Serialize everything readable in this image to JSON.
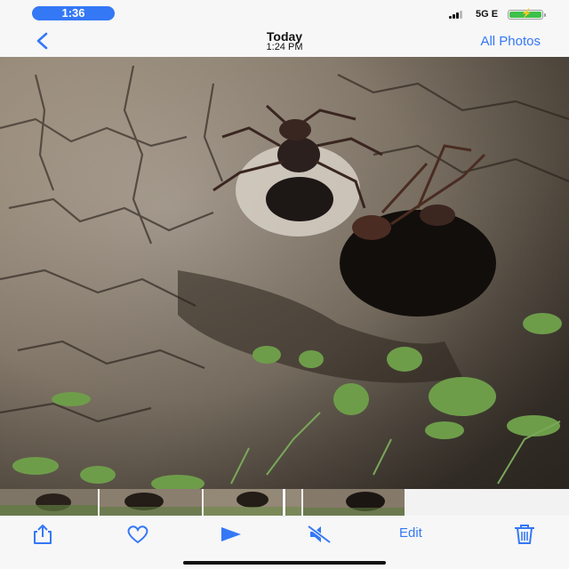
{
  "status_bar": {
    "time": "1:36",
    "network": "5G E",
    "battery_icon": "battery-charging-icon",
    "signal_icon": "cell-signal-icon"
  },
  "nav": {
    "title": "Today",
    "subtitle": "1:24 PM",
    "right_label": "All Photos",
    "back_icon": "chevron-left-icon"
  },
  "photo": {
    "description_icon": "photo-of-ants-on-soil"
  },
  "toolbar": {
    "share_icon": "share-icon",
    "favorite_icon": "heart-icon",
    "play_icon": "play-icon",
    "mute_icon": "speaker-muted-icon",
    "edit_label": "Edit",
    "delete_icon": "trash-icon"
  },
  "colors": {
    "accent": "#3478f6",
    "battery": "#3ec14a"
  }
}
